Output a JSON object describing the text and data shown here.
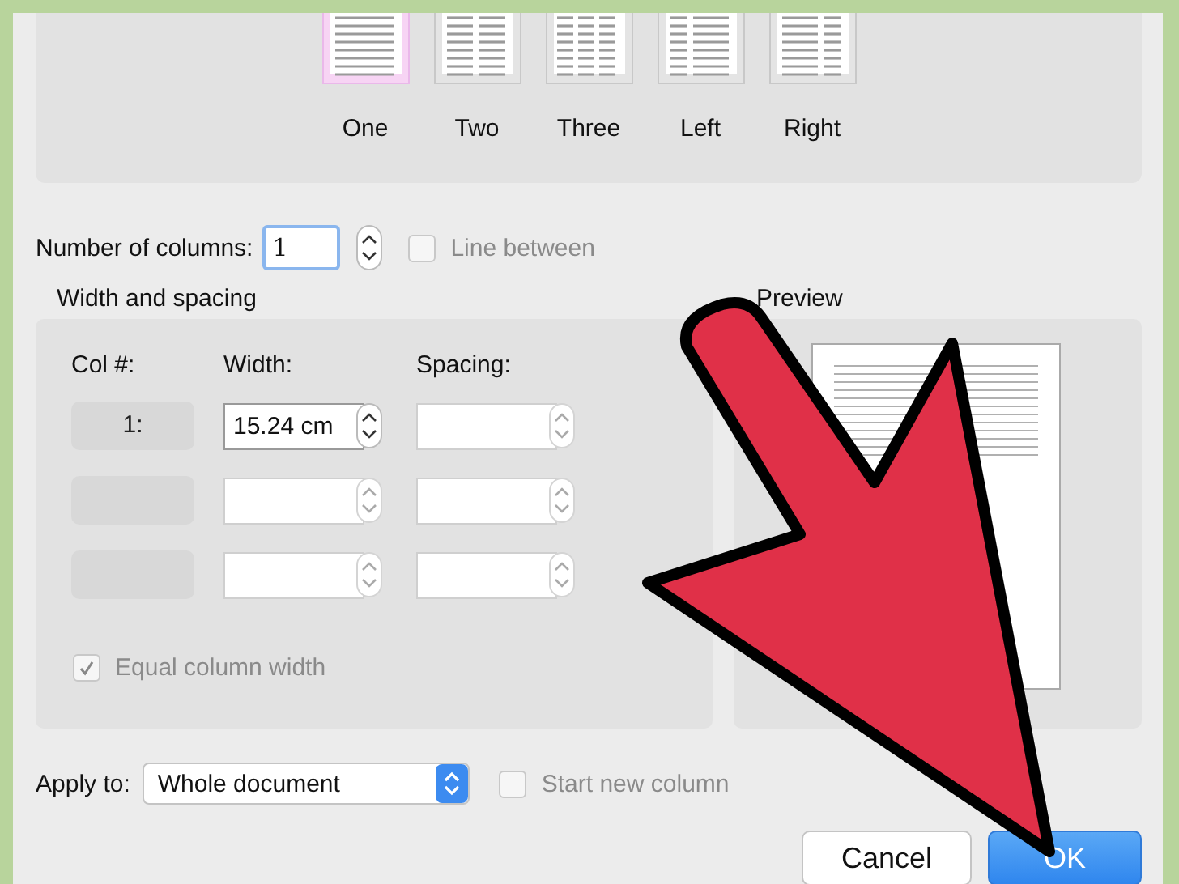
{
  "presets": [
    {
      "label": "One",
      "kind": "one",
      "selected": true
    },
    {
      "label": "Two",
      "kind": "two",
      "selected": false
    },
    {
      "label": "Three",
      "kind": "three",
      "selected": false
    },
    {
      "label": "Left",
      "kind": "left",
      "selected": false
    },
    {
      "label": "Right",
      "kind": "right",
      "selected": false
    }
  ],
  "number_of_columns": {
    "label": "Number of columns:",
    "value": "1"
  },
  "line_between": {
    "label": "Line between",
    "checked": false,
    "disabled": true
  },
  "width_spacing": {
    "title": "Width and spacing",
    "headers": [
      "Col #:",
      "Width:",
      "Spacing:"
    ],
    "rows": [
      {
        "col": "1:",
        "width": "15.24 cm",
        "disabled": false
      },
      {
        "disabled": true
      },
      {
        "disabled": true
      }
    ],
    "equal_column_width": {
      "label": "Equal column width",
      "checked": true,
      "disabled": true
    }
  },
  "preview": {
    "title": "Preview"
  },
  "apply_to": {
    "label": "Apply to:",
    "value": "Whole document"
  },
  "start_new_column": {
    "label": "Start new column",
    "checked": false,
    "disabled": true
  },
  "buttons": [
    {
      "label": "Cancel",
      "default": false
    },
    {
      "label": "OK",
      "default": true
    }
  ]
}
